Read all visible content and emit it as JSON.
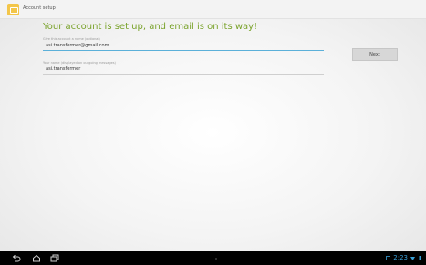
{
  "app": {
    "title": "Account setup"
  },
  "main": {
    "heading": "Your account is set up, and email is on its way!",
    "name_label": "Give this account a name (optional)",
    "name_value": "asi.transformer@gmail.com",
    "display_label": "Your name (displayed on outgoing messages)",
    "display_value": "asi.transformer",
    "next_label": "Next"
  },
  "system_bar": {
    "time": "2:23"
  },
  "colors": {
    "heading": "#79a22a",
    "focus_line": "#5bb0d9",
    "clock": "#39a0d8",
    "app_icon": "#f3c64a"
  }
}
